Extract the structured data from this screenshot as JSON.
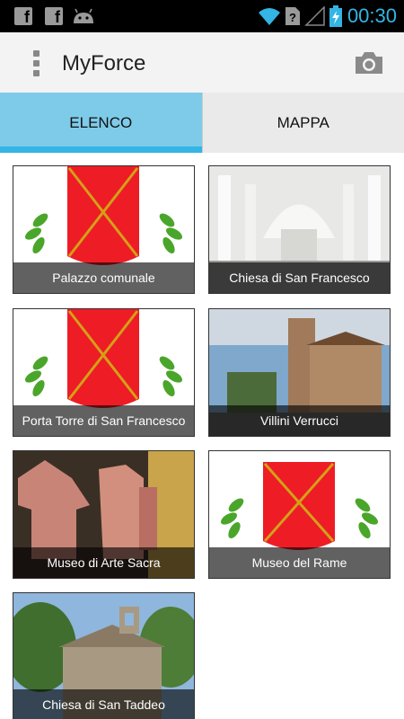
{
  "app": {
    "title": "MyForce"
  },
  "status_bar": {
    "time": "00:30",
    "left_icons": [
      "facebook-icon",
      "facebook-icon",
      "android-icon"
    ],
    "right_icons": [
      "wifi-icon",
      "no-sim-icon",
      "cell-signal-icon",
      "battery-charging-icon"
    ]
  },
  "tabs": [
    {
      "label": "ELENCO",
      "active": true
    },
    {
      "label": "MAPPA",
      "active": false
    }
  ],
  "places": [
    {
      "name": "Palazzo comunale",
      "image": "coat-of-arms"
    },
    {
      "name": "Chiesa di San Francesco",
      "image": "church-interior"
    },
    {
      "name": "Porta Torre di San Francesco",
      "image": "coat-of-arms"
    },
    {
      "name": "Villini Verrucci",
      "image": "villa-street"
    },
    {
      "name": "Museo di Arte Sacra",
      "image": "vestments"
    },
    {
      "name": "Museo del Rame",
      "image": "coat-of-arms"
    },
    {
      "name": "Chiesa di San Taddeo",
      "image": "stone-church"
    }
  ],
  "colors": {
    "accent": "#33b5e5",
    "active_tab": "#7ecbe9",
    "shield_red": "#ee1c25",
    "laurel_green": "#4aa62a"
  }
}
